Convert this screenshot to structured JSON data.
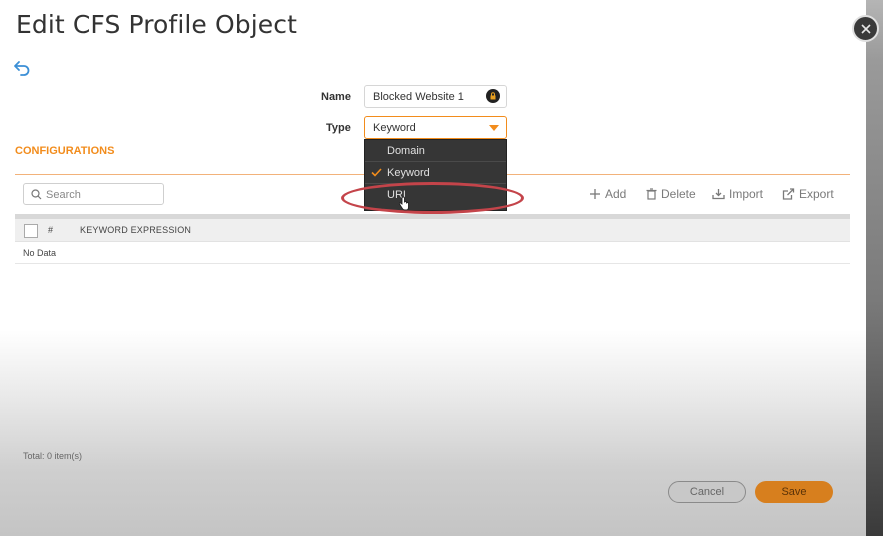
{
  "dialog": {
    "title": "Edit CFS Profile Object"
  },
  "form": {
    "name_label": "Name",
    "name_value": "Blocked Website 1",
    "type_label": "Type",
    "type_value": "Keyword"
  },
  "type_dropdown": {
    "options": [
      {
        "label": "Domain",
        "selected": false
      },
      {
        "label": "Keyword",
        "selected": true
      },
      {
        "label": "URI",
        "selected": false
      }
    ],
    "highlight_color": "#c4444a"
  },
  "configurations": {
    "section_title": "CONFIGURATIONS",
    "search_placeholder": "Search",
    "toolbar": {
      "add_label": "Add",
      "delete_label": "Delete",
      "import_label": "Import",
      "export_label": "Export"
    },
    "table": {
      "columns": [
        "#",
        "KEYWORD EXPRESSION"
      ],
      "empty_text": "No Data"
    },
    "total_text": "Total: 0 item(s)"
  },
  "footer": {
    "cancel_label": "Cancel",
    "save_label": "Save"
  },
  "colors": {
    "accent": "#f28c1c",
    "save_button": "#d77f1e"
  },
  "icons": {
    "back": "undo-arrow-icon",
    "close": "close-icon",
    "lock": "lock-icon",
    "search": "search-icon",
    "add": "plus-icon",
    "delete": "trash-icon",
    "import": "import-icon",
    "export": "export-icon"
  }
}
